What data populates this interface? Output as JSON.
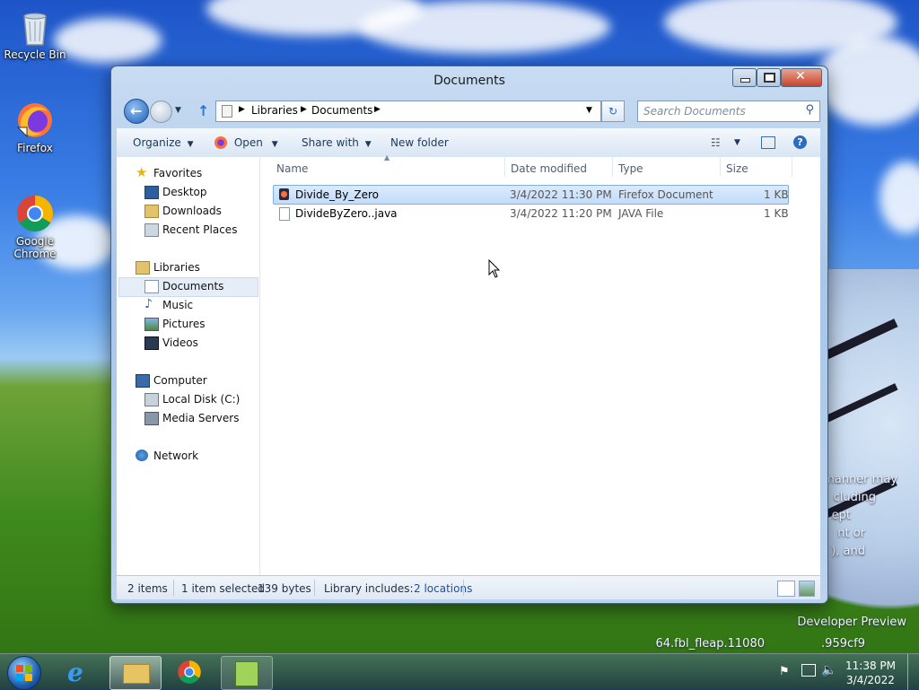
{
  "desktop": {
    "icons": [
      {
        "label": "Recycle Bin",
        "icon": "recycle-bin-icon"
      },
      {
        "label": "Firefox",
        "icon": "firefox-icon"
      },
      {
        "label": "Google Chrome",
        "icon": "chrome-icon"
      }
    ],
    "watermark": {
      "line1": "manner may",
      "line2": "cluding",
      "line3": "ept",
      "line4": "nt or",
      "line5": "), and",
      "build1": "Developer Preview",
      "build2": "64.fbl_fleap.11080",
      "build3": ".959cf9"
    }
  },
  "window": {
    "title": "Documents",
    "breadcrumb": [
      "Libraries",
      "Documents"
    ],
    "search_placeholder": "Search Documents",
    "toolbar": {
      "organize": "Organize",
      "open": "Open",
      "share_with": "Share with",
      "new_folder": "New folder"
    },
    "nav": {
      "favorites": "Favorites",
      "desktop": "Desktop",
      "downloads": "Downloads",
      "recent_places": "Recent Places",
      "libraries": "Libraries",
      "documents": "Documents",
      "music": "Music",
      "pictures": "Pictures",
      "videos": "Videos",
      "computer": "Computer",
      "local_disk": "Local Disk (C:)",
      "media_servers": "Media Servers",
      "network": "Network"
    },
    "columns": {
      "name": "Name",
      "date_modified": "Date modified",
      "type": "Type",
      "size": "Size"
    },
    "files": [
      {
        "name": "Divide_By_Zero",
        "date": "3/4/2022 11:30 PM",
        "type": "Firefox Document",
        "size": "1 KB"
      },
      {
        "name": "DivideByZero..java",
        "date": "3/4/2022 11:20 PM",
        "type": "JAVA File",
        "size": "1 KB"
      }
    ],
    "status": {
      "items": "2 items",
      "selected": "1 item selected",
      "bytes": "139 bytes",
      "library": "Library includes:",
      "locations": "2 locations"
    }
  },
  "taskbar": {
    "time": "11:38 PM",
    "date": "3/4/2022"
  },
  "colors": {
    "accent": "#3a7ee6",
    "selection": "#c1dcfb"
  }
}
